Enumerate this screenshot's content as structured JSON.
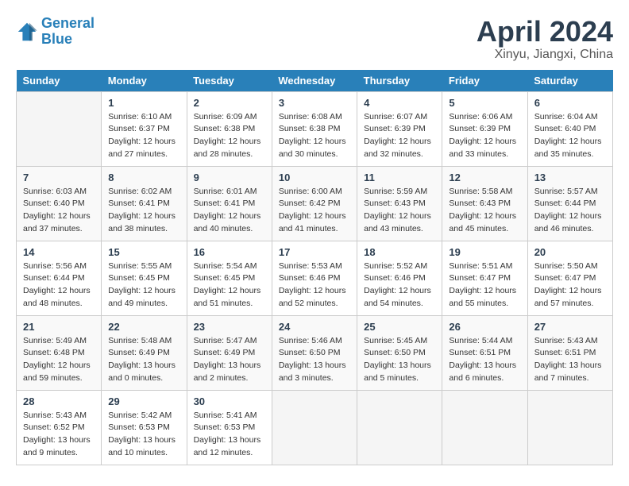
{
  "logo": {
    "line1": "General",
    "line2": "Blue"
  },
  "title": "April 2024",
  "subtitle": "Xinyu, Jiangxi, China",
  "weekdays": [
    "Sunday",
    "Monday",
    "Tuesday",
    "Wednesday",
    "Thursday",
    "Friday",
    "Saturday"
  ],
  "weeks": [
    [
      {
        "num": "",
        "info": ""
      },
      {
        "num": "1",
        "info": "Sunrise: 6:10 AM\nSunset: 6:37 PM\nDaylight: 12 hours\nand 27 minutes."
      },
      {
        "num": "2",
        "info": "Sunrise: 6:09 AM\nSunset: 6:38 PM\nDaylight: 12 hours\nand 28 minutes."
      },
      {
        "num": "3",
        "info": "Sunrise: 6:08 AM\nSunset: 6:38 PM\nDaylight: 12 hours\nand 30 minutes."
      },
      {
        "num": "4",
        "info": "Sunrise: 6:07 AM\nSunset: 6:39 PM\nDaylight: 12 hours\nand 32 minutes."
      },
      {
        "num": "5",
        "info": "Sunrise: 6:06 AM\nSunset: 6:39 PM\nDaylight: 12 hours\nand 33 minutes."
      },
      {
        "num": "6",
        "info": "Sunrise: 6:04 AM\nSunset: 6:40 PM\nDaylight: 12 hours\nand 35 minutes."
      }
    ],
    [
      {
        "num": "7",
        "info": "Sunrise: 6:03 AM\nSunset: 6:40 PM\nDaylight: 12 hours\nand 37 minutes."
      },
      {
        "num": "8",
        "info": "Sunrise: 6:02 AM\nSunset: 6:41 PM\nDaylight: 12 hours\nand 38 minutes."
      },
      {
        "num": "9",
        "info": "Sunrise: 6:01 AM\nSunset: 6:41 PM\nDaylight: 12 hours\nand 40 minutes."
      },
      {
        "num": "10",
        "info": "Sunrise: 6:00 AM\nSunset: 6:42 PM\nDaylight: 12 hours\nand 41 minutes."
      },
      {
        "num": "11",
        "info": "Sunrise: 5:59 AM\nSunset: 6:43 PM\nDaylight: 12 hours\nand 43 minutes."
      },
      {
        "num": "12",
        "info": "Sunrise: 5:58 AM\nSunset: 6:43 PM\nDaylight: 12 hours\nand 45 minutes."
      },
      {
        "num": "13",
        "info": "Sunrise: 5:57 AM\nSunset: 6:44 PM\nDaylight: 12 hours\nand 46 minutes."
      }
    ],
    [
      {
        "num": "14",
        "info": "Sunrise: 5:56 AM\nSunset: 6:44 PM\nDaylight: 12 hours\nand 48 minutes."
      },
      {
        "num": "15",
        "info": "Sunrise: 5:55 AM\nSunset: 6:45 PM\nDaylight: 12 hours\nand 49 minutes."
      },
      {
        "num": "16",
        "info": "Sunrise: 5:54 AM\nSunset: 6:45 PM\nDaylight: 12 hours\nand 51 minutes."
      },
      {
        "num": "17",
        "info": "Sunrise: 5:53 AM\nSunset: 6:46 PM\nDaylight: 12 hours\nand 52 minutes."
      },
      {
        "num": "18",
        "info": "Sunrise: 5:52 AM\nSunset: 6:46 PM\nDaylight: 12 hours\nand 54 minutes."
      },
      {
        "num": "19",
        "info": "Sunrise: 5:51 AM\nSunset: 6:47 PM\nDaylight: 12 hours\nand 55 minutes."
      },
      {
        "num": "20",
        "info": "Sunrise: 5:50 AM\nSunset: 6:47 PM\nDaylight: 12 hours\nand 57 minutes."
      }
    ],
    [
      {
        "num": "21",
        "info": "Sunrise: 5:49 AM\nSunset: 6:48 PM\nDaylight: 12 hours\nand 59 minutes."
      },
      {
        "num": "22",
        "info": "Sunrise: 5:48 AM\nSunset: 6:49 PM\nDaylight: 13 hours\nand 0 minutes."
      },
      {
        "num": "23",
        "info": "Sunrise: 5:47 AM\nSunset: 6:49 PM\nDaylight: 13 hours\nand 2 minutes."
      },
      {
        "num": "24",
        "info": "Sunrise: 5:46 AM\nSunset: 6:50 PM\nDaylight: 13 hours\nand 3 minutes."
      },
      {
        "num": "25",
        "info": "Sunrise: 5:45 AM\nSunset: 6:50 PM\nDaylight: 13 hours\nand 5 minutes."
      },
      {
        "num": "26",
        "info": "Sunrise: 5:44 AM\nSunset: 6:51 PM\nDaylight: 13 hours\nand 6 minutes."
      },
      {
        "num": "27",
        "info": "Sunrise: 5:43 AM\nSunset: 6:51 PM\nDaylight: 13 hours\nand 7 minutes."
      }
    ],
    [
      {
        "num": "28",
        "info": "Sunrise: 5:43 AM\nSunset: 6:52 PM\nDaylight: 13 hours\nand 9 minutes."
      },
      {
        "num": "29",
        "info": "Sunrise: 5:42 AM\nSunset: 6:53 PM\nDaylight: 13 hours\nand 10 minutes."
      },
      {
        "num": "30",
        "info": "Sunrise: 5:41 AM\nSunset: 6:53 PM\nDaylight: 13 hours\nand 12 minutes."
      },
      {
        "num": "",
        "info": ""
      },
      {
        "num": "",
        "info": ""
      },
      {
        "num": "",
        "info": ""
      },
      {
        "num": "",
        "info": ""
      }
    ]
  ]
}
